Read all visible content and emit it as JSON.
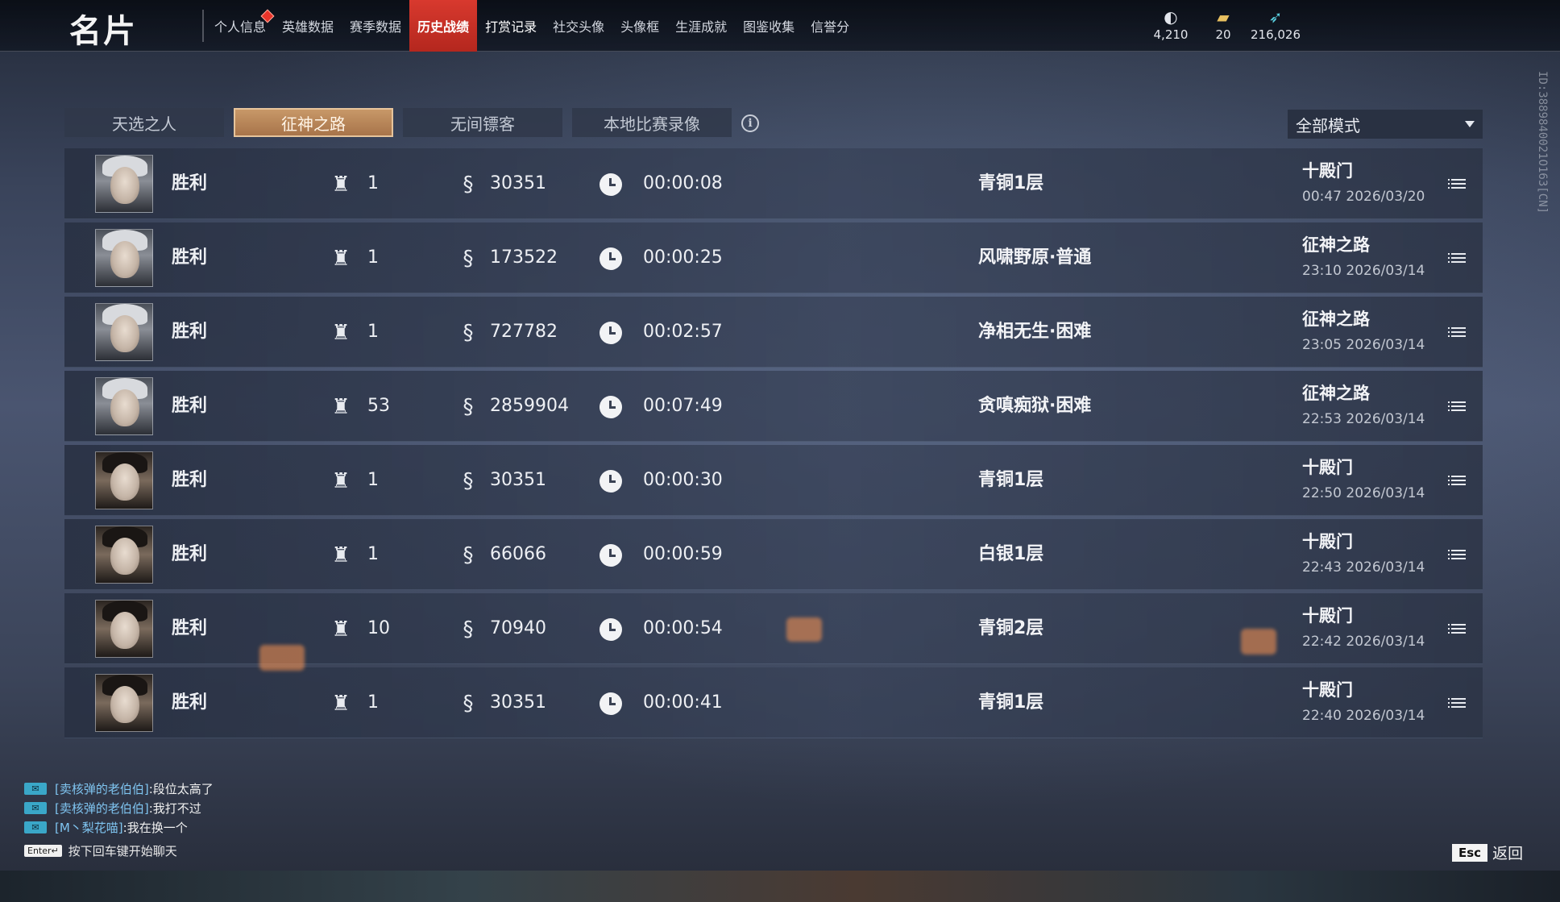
{
  "header": {
    "title": "名片",
    "nav_tabs": [
      {
        "label": "个人信息"
      },
      {
        "label": "英雄数据"
      },
      {
        "label": "赛季数据"
      },
      {
        "label": "历史战绩"
      },
      {
        "label": "打赏记录"
      },
      {
        "label": "社交头像"
      },
      {
        "label": "头像框"
      },
      {
        "label": "生涯成就"
      },
      {
        "label": "图鉴收集"
      },
      {
        "label": "信誉分"
      }
    ],
    "active_tab": "历史战绩",
    "currencies": [
      {
        "icon": "coin-bag-icon",
        "value": "4,210"
      },
      {
        "icon": "ticket-icon",
        "value": "20"
      },
      {
        "icon": "feather-icon",
        "value": "216,026"
      }
    ]
  },
  "filters": {
    "tabs": [
      {
        "label": "天选之人"
      },
      {
        "label": "征神之路"
      },
      {
        "label": "无间镖客"
      },
      {
        "label": "本地比赛录像"
      }
    ],
    "active": "征神之路",
    "mode_select": "全部模式"
  },
  "matches": [
    {
      "result": "胜利",
      "rank": "1",
      "score": "30351",
      "duration": "00:00:08",
      "stage": "青铜1层",
      "mode": "十殿门",
      "time": "00:47  2026/03/20"
    },
    {
      "result": "胜利",
      "rank": "1",
      "score": "173522",
      "duration": "00:00:25",
      "stage": "风啸野原·普通",
      "mode": "征神之路",
      "time": "23:10  2026/03/14"
    },
    {
      "result": "胜利",
      "rank": "1",
      "score": "727782",
      "duration": "00:02:57",
      "stage": "净相无生·困难",
      "mode": "征神之路",
      "time": "23:05  2026/03/14"
    },
    {
      "result": "胜利",
      "rank": "53",
      "score": "2859904",
      "duration": "00:07:49",
      "stage": "贪嗔痴狱·困难",
      "mode": "征神之路",
      "time": "22:53  2026/03/14"
    },
    {
      "result": "胜利",
      "rank": "1",
      "score": "30351",
      "duration": "00:00:30",
      "stage": "青铜1层",
      "mode": "十殿门",
      "time": "22:50  2026/03/14"
    },
    {
      "result": "胜利",
      "rank": "1",
      "score": "66066",
      "duration": "00:00:59",
      "stage": "白银1层",
      "mode": "十殿门",
      "time": "22:43  2026/03/14"
    },
    {
      "result": "胜利",
      "rank": "10",
      "score": "70940",
      "duration": "00:00:54",
      "stage": "青铜2层",
      "mode": "十殿门",
      "time": "22:42  2026/03/14"
    },
    {
      "result": "胜利",
      "rank": "1",
      "score": "30351",
      "duration": "00:00:41",
      "stage": "青铜1层",
      "mode": "十殿门",
      "time": "22:40  2026/03/14"
    }
  ],
  "chat": {
    "messages": [
      {
        "name": "[卖核弹的老伯伯]",
        "text": ":段位太高了"
      },
      {
        "name": "[卖核弹的老伯伯]",
        "text": ":我打不过"
      },
      {
        "name": "[M丶梨花喵]",
        "text": ":我在换一个"
      }
    ],
    "enter_key": "Enter↵",
    "hint": "按下回车键开始聊天"
  },
  "footer": {
    "esc_key": "Esc",
    "back_label": "返回"
  },
  "side_id": "ID:3889840021O163[CN]"
}
